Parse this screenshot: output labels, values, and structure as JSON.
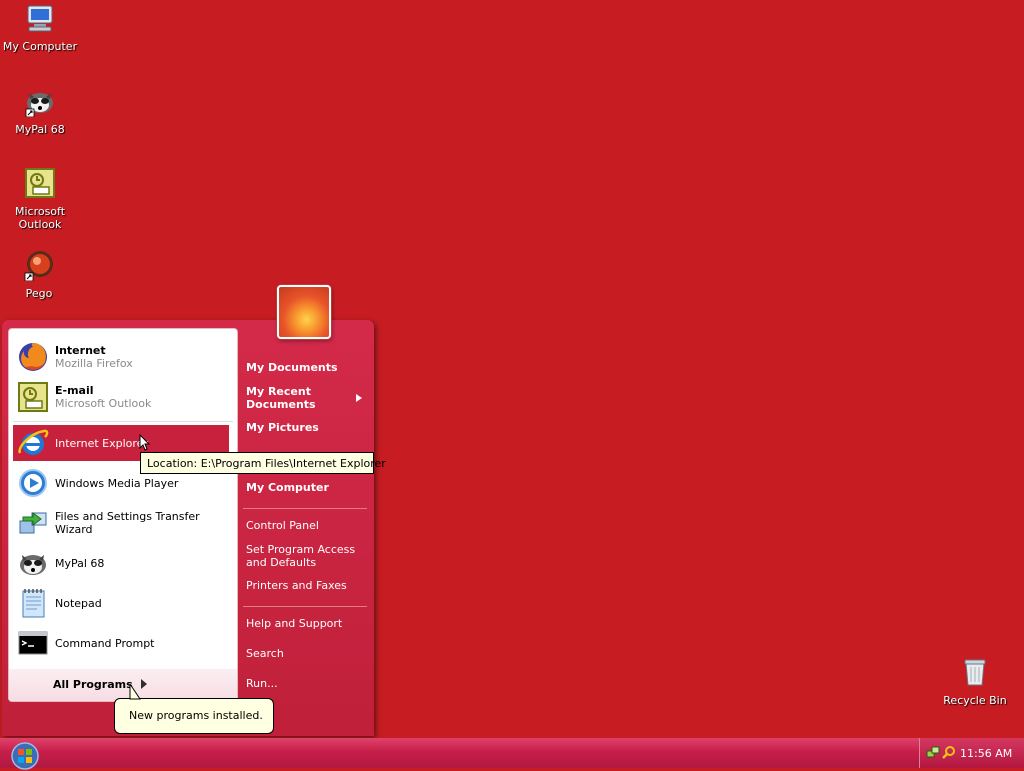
{
  "desktop": {
    "icons": [
      {
        "label": "My Computer",
        "icon": "my-computer-icon"
      },
      {
        "label": "MyPal 68",
        "icon": "mypal-icon"
      },
      {
        "label": "Microsoft Outlook",
        "icon": "outlook-icon"
      },
      {
        "label": "Pego",
        "icon": "pego-icon"
      },
      {
        "label": "Recycle Bin",
        "icon": "recycle-bin-icon"
      }
    ]
  },
  "start_menu": {
    "pinned": [
      {
        "title": "Internet",
        "subtitle": "Mozilla Firefox",
        "icon": "firefox-icon"
      },
      {
        "title": "E-mail",
        "subtitle": "Microsoft Outlook",
        "icon": "outlook-icon"
      }
    ],
    "recent": [
      {
        "label": "Internet Explorer",
        "icon": "internet-explorer-icon"
      },
      {
        "label": "Windows Media Player",
        "icon": "media-player-icon"
      },
      {
        "label": "Files and Settings Transfer Wizard",
        "icon": "transfer-wizard-icon"
      },
      {
        "label": "MyPal 68",
        "icon": "mypal-icon"
      },
      {
        "label": "Notepad",
        "icon": "notepad-icon"
      },
      {
        "label": "Command Prompt",
        "icon": "command-prompt-icon"
      }
    ],
    "all_programs": "All Programs",
    "right": {
      "my_documents": "My Documents",
      "my_recent_documents": "My Recent Documents",
      "my_pictures": "My Pictures",
      "my_computer": "My Computer",
      "control_panel": "Control Panel",
      "set_program_access": "Set Program Access and Defaults",
      "printers_faxes": "Printers and Faxes",
      "help_support": "Help and Support",
      "search": "Search",
      "run": "Run..."
    }
  },
  "tooltip": "Location: E:\\Program Files\\Internet Explorer",
  "balloon": "New programs installed.",
  "taskbar": {
    "clock": "11:56 AM"
  },
  "colors": {
    "desktop": "#c71d22",
    "start_menu": "#c8213d",
    "highlight": "#c8213d"
  }
}
